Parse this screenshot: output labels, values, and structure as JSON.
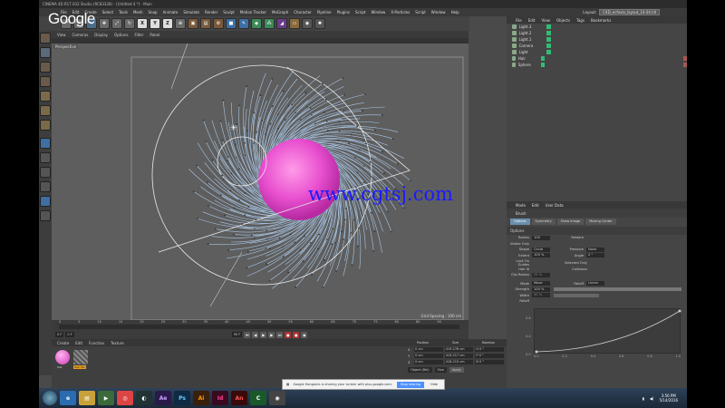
{
  "app": {
    "title": "CINEMA 4D R17.032 Studio (RC83328) - [Untitled 4 *] - Main",
    "watermark": "www.cgtsj.com",
    "logo": "Google"
  },
  "menubar": {
    "items": [
      "File",
      "Edit",
      "Create",
      "Select",
      "Tools",
      "Mesh",
      "Snap",
      "Animate",
      "Simulate",
      "Render",
      "Sculpt",
      "Motion Tracker",
      "MoGraph",
      "Character",
      "Pipeline",
      "Plugins",
      "Script",
      "Window",
      "X-Particles",
      "Script",
      "Window",
      "Help"
    ],
    "layout_label": "Layout:",
    "layout_value": "C4D_ecfaxlv_layout_14.04.ldl"
  },
  "toolbar": {
    "buttons": [
      "undo",
      "redo",
      "select",
      "move",
      "scale",
      "rotate",
      "X",
      "Y",
      "Z",
      "coord",
      "render",
      "render-view",
      "render-settings",
      "cube",
      "pen",
      "subdivide",
      "array",
      "deformer",
      "floor",
      "camera",
      "light"
    ]
  },
  "viewport": {
    "menu": [
      "View",
      "Cameras",
      "Display",
      "Options",
      "Filter",
      "Panel"
    ],
    "label": "Perspective",
    "grid_spacing": "Grid Spacing : 100 cm"
  },
  "timeline": {
    "ticks": [
      "0",
      "5",
      "10",
      "15",
      "20",
      "25",
      "30",
      "35",
      "40",
      "45",
      "50",
      "55",
      "60",
      "65",
      "70",
      "75",
      "80",
      "85",
      "90"
    ],
    "current": "0 F",
    "start": "0 F",
    "end": "90 F"
  },
  "materials": {
    "menu": [
      "Create",
      "Edit",
      "Function",
      "Texture"
    ],
    "items": [
      {
        "name": "Mat"
      },
      {
        "name": "Hair Ma"
      }
    ]
  },
  "coords": {
    "headers": [
      "Position",
      "Size",
      "Rotation"
    ],
    "rows": [
      {
        "axis": "X",
        "pos": "0 cm",
        "size": "419.276 cm",
        "rot": "H 0 °"
      },
      {
        "axis": "Y",
        "pos": "0 cm",
        "size": "419.217 cm",
        "rot": "P 0 °"
      },
      {
        "axis": "Z",
        "pos": "0 cm",
        "size": "418.215 cm",
        "rot": "B 0 °"
      }
    ],
    "mode": "Object (Rel)",
    "size_mode": "Size",
    "apply": "Apply"
  },
  "objects": {
    "menu": [
      "File",
      "Edit",
      "View",
      "Objects",
      "Tags",
      "Bookmarks"
    ],
    "items": [
      "Light.3",
      "Light.2",
      "Light.1",
      "Camera",
      "Light",
      "Hair",
      "Sphere"
    ]
  },
  "attributes": {
    "menu": [
      "Mode",
      "Edit",
      "User Data"
    ],
    "title": "Brush",
    "tabs": [
      "Options",
      "Symmetry",
      "Show Image",
      "Moving Center"
    ],
    "section": "Options",
    "fields": {
      "radius_label": "Radius",
      "radius": "100",
      "visible_only_label": "Visible Only",
      "shape_label": "Shape",
      "shape": "Circle",
      "extent_label": "Extent",
      "extent": "100 %",
      "use_on_guides_label": "Lock On Guides",
      "hair_label": "Hair III",
      "clip_radius_label": "Clip Radius",
      "clip_radius": "25 %",
      "restore_label": "Restore",
      "pressure_label": "Pressure",
      "pressure": "None",
      "angle_label": "Angle",
      "angle": "0 °",
      "selected_only_label": "Selected Only",
      "collisions_label": "Collisions",
      "mode_label": "Mode",
      "mode": "Move",
      "falloff_label": "Falloff",
      "falloff": "Linear",
      "strength_label": "Strength",
      "strength": "100 %",
      "width_label": "Width",
      "width": "50 %",
      "falloff2_label": "Falloff"
    },
    "graph_ticks": [
      "0.0",
      "0.2",
      "0.4",
      "0.6",
      "0.8",
      "1.0"
    ],
    "graph_y": [
      "0.8",
      "0.4",
      "0.0"
    ]
  },
  "share_bar": {
    "text": "Google Hangouts is sharing your screen with plus.google.com.",
    "stop": "Stop sharing",
    "hide": "Hide"
  },
  "clock": {
    "time": "3:56 PM",
    "date": "5/14/2016"
  },
  "taskbar": [
    "IE",
    "Explorer",
    "Media",
    "Chrome",
    "C4D",
    "AE",
    "PS",
    "AI",
    "ID",
    "AN",
    "Camtasia",
    "Capture"
  ]
}
